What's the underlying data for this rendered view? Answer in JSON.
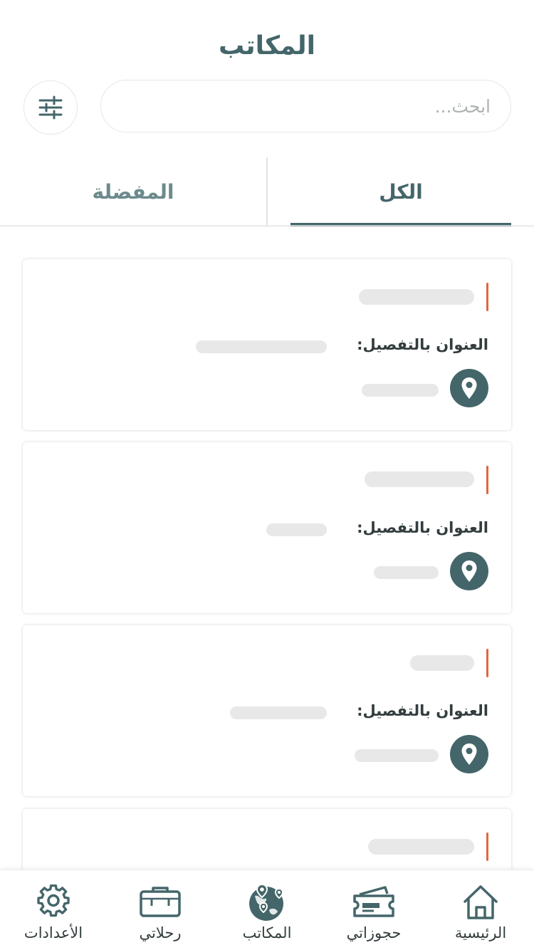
{
  "header": {
    "title": "المكاتب"
  },
  "search": {
    "placeholder": "ابحث..."
  },
  "tabs": [
    {
      "label": "الكل",
      "active": true
    },
    {
      "label": "المفضلة",
      "active": false
    }
  ],
  "cards": [
    {
      "address_label": "العنوان بالتفصيل:"
    },
    {
      "address_label": "العنوان بالتفصيل:"
    },
    {
      "address_label": "العنوان بالتفصيل:"
    },
    {
      "address_label": ""
    }
  ],
  "bottom_nav": [
    {
      "label": "الرئيسية",
      "icon": "home-icon",
      "active": false
    },
    {
      "label": "حجوزاتي",
      "icon": "ticket-icon",
      "active": false
    },
    {
      "label": "المكاتب",
      "icon": "globe-pins-icon",
      "active": true
    },
    {
      "label": "رحلاتي",
      "icon": "suitcase-icon",
      "active": false
    },
    {
      "label": "الأعدادات",
      "icon": "gear-icon",
      "active": false
    }
  ],
  "colors": {
    "primary": "#44666a",
    "accent": "#e0663e",
    "skeleton": "#e8e8e8"
  }
}
